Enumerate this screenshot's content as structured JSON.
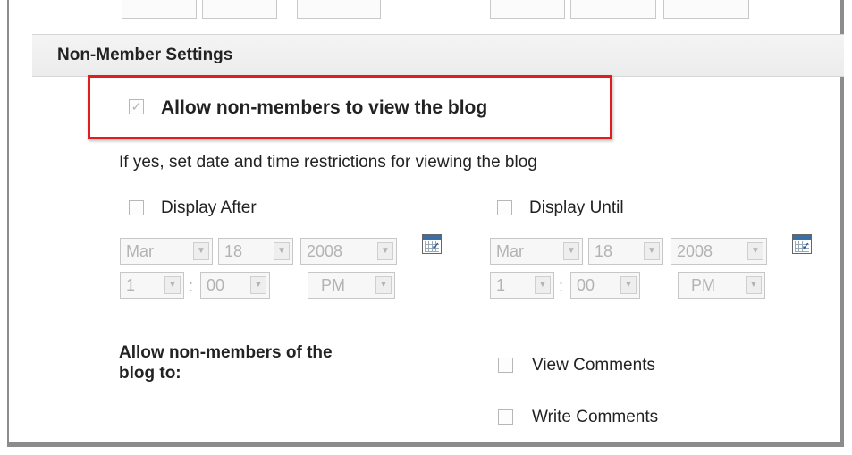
{
  "section": {
    "title": "Non-Member Settings"
  },
  "allow_view": {
    "label": "Allow non-members to view the blog",
    "checked": true
  },
  "restriction_hint": "If yes, set date and time restrictions for viewing the blog",
  "display_after": {
    "label": "Display After",
    "month": "Mar",
    "day": "18",
    "year": "2008",
    "hour": "1",
    "minute": "00",
    "ampm": "PM"
  },
  "display_until": {
    "label": "Display Until",
    "month": "Mar",
    "day": "18",
    "year": "2008",
    "hour": "1",
    "minute": "00",
    "ampm": "PM"
  },
  "time_separator": ":",
  "permissions": {
    "heading_line1": "Allow non-members of the",
    "heading_line2": "blog to:",
    "view_comments": "View Comments",
    "write_comments": "Write Comments"
  },
  "icons": {
    "calendar": "calendar-icon",
    "dropdown": "chevron-down-icon",
    "check": "check-icon"
  },
  "colors": {
    "highlight_border": "#e01e1e",
    "disabled_text": "#b3b3b3",
    "header_bg": "#ececec"
  }
}
